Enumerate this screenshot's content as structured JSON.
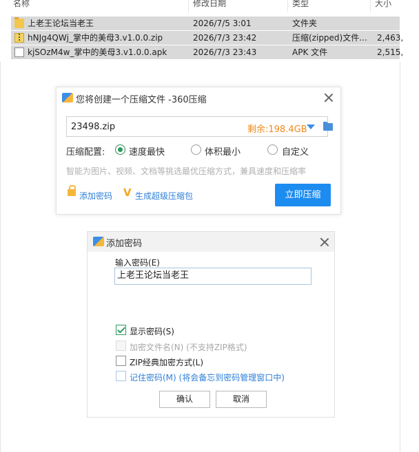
{
  "explorer": {
    "columns": [
      "名称",
      "修改日期",
      "类型",
      "大小"
    ],
    "rows": [
      {
        "name": "上老王论坛当老王",
        "date": "2026/7/5 3:01",
        "type": "文件夹",
        "size": "",
        "icon": "folder-icon"
      },
      {
        "name": "hNJg4QWj_掌中的美母3.v1.0.0.zip",
        "date": "2026/7/3 23:42",
        "type": "压缩(zipped)文件...",
        "size": "2,463,",
        "icon": "zip-file-icon"
      },
      {
        "name": "kjSOzM4w_掌中的美母3.v1.0.0.apk",
        "date": "2026/7/3 23:43",
        "type": "APK 文件",
        "size": "2,515,",
        "icon": "apk-file-icon"
      }
    ]
  },
  "zip_dialog": {
    "title": "您将创建一个压缩文件 -360压缩",
    "filename": "23498.zip",
    "remaining": "剩余:198.4GB",
    "config_label": "压缩配置:",
    "options": [
      "速度最快",
      "体积最小",
      "自定义"
    ],
    "selected_option": "速度最快",
    "hint": "智能为图片、视频、文档等挑选最优压缩方式，兼具速度和压缩率",
    "add_password": "添加密码",
    "super_pack": "生成超级压缩包",
    "compress_button": "立即压缩"
  },
  "password_dialog": {
    "title": "添加密码",
    "input_label": "输入密码(E)",
    "password_value": "上老王论坛当老王",
    "checkboxes": [
      {
        "label": "显示密码(S)",
        "checked": true,
        "enabled": true
      },
      {
        "label": "加密文件名(N) (不支持ZIP格式)",
        "checked": false,
        "enabled": false
      },
      {
        "label": "ZIP经典加密方式(L)",
        "checked": false,
        "enabled": true
      },
      {
        "label": "记住密码(M) (将会备忘到密码管理窗口中)",
        "checked": false,
        "enabled": true
      }
    ],
    "ok_button": "确认",
    "cancel_button": "取消"
  },
  "colors": {
    "accent_blue": "#1d8cf0",
    "link_blue": "#2f7fd8",
    "remaining_orange": "#f08a18",
    "check_green": "#2e9b5f",
    "selection_gray": "#d9d9d9"
  }
}
